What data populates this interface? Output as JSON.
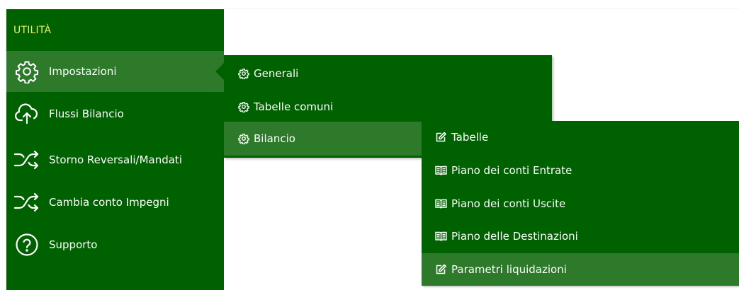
{
  "menu": {
    "header": "UTILITÀ",
    "items": [
      {
        "label": "Impostazioni",
        "icon": "gear-icon"
      },
      {
        "label": "Flussi Bilancio",
        "icon": "cloud-upload-icon"
      },
      {
        "label": "Storno Reversali/Mandati",
        "icon": "shuffle-icon"
      },
      {
        "label": "Cambia conto Impegni",
        "icon": "shuffle-icon"
      },
      {
        "label": "Supporto",
        "icon": "question-circle-icon"
      }
    ]
  },
  "submenu_impostazioni": {
    "items": [
      {
        "label": "Generali",
        "icon": "gear-icon"
      },
      {
        "label": "Tabelle comuni",
        "icon": "gear-icon"
      },
      {
        "label": "Bilancio",
        "icon": "gear-icon"
      }
    ]
  },
  "submenu_bilancio": {
    "items": [
      {
        "label": "Tabelle",
        "icon": "edit-icon"
      },
      {
        "label": "Piano dei conti Entrate",
        "icon": "book-icon"
      },
      {
        "label": "Piano dei conti Uscite",
        "icon": "book-icon"
      },
      {
        "label": "Piano delle Destinazioni",
        "icon": "book-icon"
      },
      {
        "label": "Parametri liquidazioni",
        "icon": "edit-icon"
      }
    ]
  },
  "colors": {
    "menu_bg": "#006100",
    "hover_bg": "#2e7a2b",
    "header_text": "#e8f06a",
    "text": "#ffffff"
  }
}
